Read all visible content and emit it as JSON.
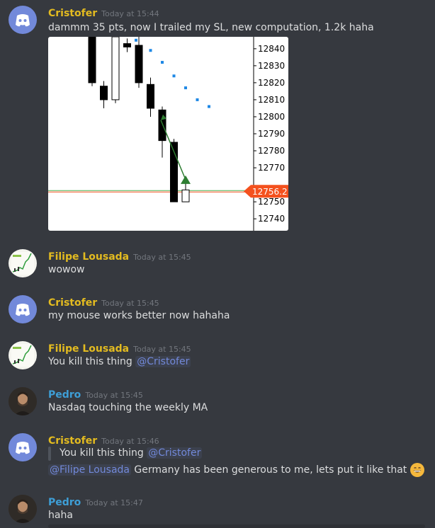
{
  "messages": [
    {
      "author": "Cristofer",
      "timestamp": "Today at 15:44",
      "text": "dammm 35 pts, now I trailed my SL, new computation, 1.2k haha",
      "avatar_icon": "discord-logo-icon"
    },
    {
      "author": "Filipe Lousada",
      "timestamp": "Today at 15:45",
      "text": "wowow",
      "avatar_icon": "chart-thumbnail-avatar"
    },
    {
      "author": "Cristofer",
      "timestamp": "Today at 15:45",
      "text": "my mouse works better now hahaha",
      "avatar_icon": "discord-logo-icon"
    },
    {
      "author": "Filipe Lousada",
      "timestamp": "Today at 15:45",
      "text": "You kill this thing ",
      "mention": "@Cristofer",
      "avatar_icon": "chart-thumbnail-avatar"
    },
    {
      "author": "Pedro",
      "timestamp": "Today at 15:45",
      "text": "Nasdaq touching the weekly MA",
      "avatar_icon": "user-photo-avatar"
    },
    {
      "author": "Cristofer",
      "timestamp": "Today at 15:46",
      "quote_text": "You kill this thing ",
      "quote_mention": "@Cristofer",
      "mention": "@Filipe Lousada",
      "text": " Germany has been generous to me, lets put it like that",
      "emoji": "grinning-face-emoji",
      "avatar_icon": "discord-logo-icon"
    },
    {
      "author": "Pedro",
      "timestamp": "Today at 15:47",
      "text": "haha",
      "avatar_icon": "user-photo-avatar"
    }
  ],
  "colors": {
    "background": "#36393f",
    "author_gold": "#e3bb20",
    "author_blue": "#3e9ed6",
    "mention": "#7289da",
    "price_tag": "#f4511e"
  },
  "chart_data": {
    "type": "candlestick",
    "y_ticks": [
      "12840",
      "12830",
      "12820",
      "12810",
      "12800",
      "12790",
      "12780",
      "12770",
      "12750",
      "12740"
    ],
    "current_price_label": "12756.2",
    "current_price": 12756.2,
    "ylim": [
      12733,
      12847
    ],
    "candles": [
      {
        "open": 12847,
        "close": 12820,
        "high": 12847,
        "low": 12818
      },
      {
        "open": 12818,
        "close": 12810,
        "high": 12821,
        "low": 12805
      },
      {
        "open": 12810,
        "close": 12847,
        "high": 12847,
        "low": 12808
      },
      {
        "open": 12843,
        "close": 12841,
        "high": 12846,
        "low": 12838
      },
      {
        "open": 12842,
        "close": 12820,
        "high": 12847,
        "low": 12817
      },
      {
        "open": 12819,
        "close": 12805,
        "high": 12823,
        "low": 12800
      },
      {
        "open": 12804,
        "close": 12786,
        "high": 12806,
        "low": 12776
      },
      {
        "open": 12785,
        "close": 12750,
        "high": 12787,
        "low": 12750
      },
      {
        "open": 12750,
        "close": 12757,
        "high": 12762,
        "low": 12750
      }
    ],
    "sar_dots": [
      12845,
      12839,
      12832,
      12824,
      12817,
      12810,
      12806
    ]
  }
}
